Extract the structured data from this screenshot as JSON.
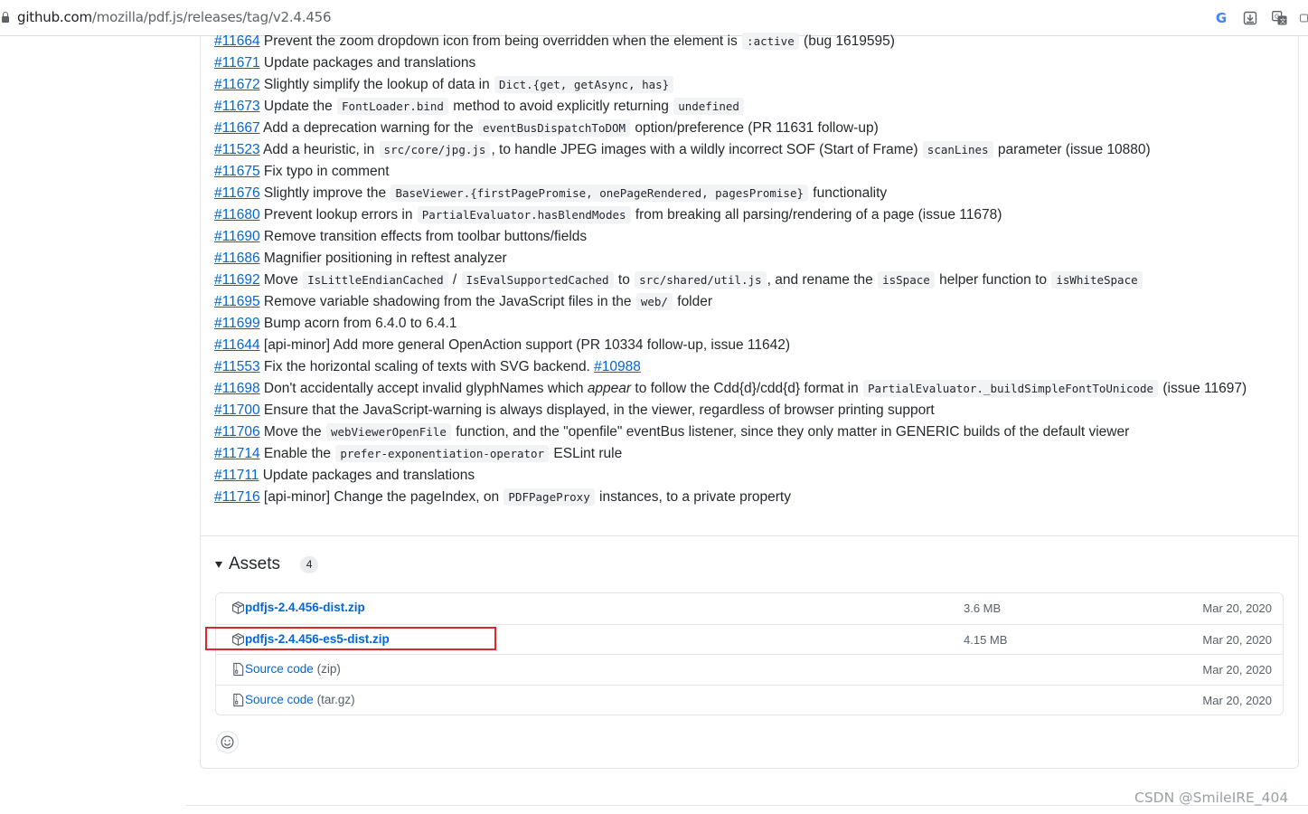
{
  "browser": {
    "url_host": "github.com",
    "url_path": "/mozilla/pdf.js/releases/tag/v2.4.456",
    "icons": [
      "lock-icon",
      "google-icon",
      "download-icon",
      "translate-icon"
    ]
  },
  "notes": [
    {
      "id": "#11664",
      "parts": [
        {
          "t": " Prevent the zoom dropdown icon from being overridden when the element is "
        },
        {
          "c": ":active"
        },
        {
          "t": " (bug 1619595)"
        }
      ]
    },
    {
      "id": "#11671",
      "parts": [
        {
          "t": " Update packages and translations"
        }
      ]
    },
    {
      "id": "#11672",
      "parts": [
        {
          "t": " Slightly simplify the lookup of data in "
        },
        {
          "c": "Dict.{get, getAsync, has}"
        }
      ]
    },
    {
      "id": "#11673",
      "parts": [
        {
          "t": " Update the "
        },
        {
          "c": "FontLoader.bind"
        },
        {
          "t": " method to avoid explicitly returning "
        },
        {
          "c": "undefined"
        }
      ]
    },
    {
      "id": "#11667",
      "parts": [
        {
          "t": " Add a deprecation warning for the "
        },
        {
          "c": "eventBusDispatchToDOM"
        },
        {
          "t": " option/preference (PR 11631 follow-up)"
        }
      ]
    },
    {
      "id": "#11523",
      "parts": [
        {
          "t": " Add a heuristic, in "
        },
        {
          "c": "src/core/jpg.js"
        },
        {
          "t": ", to handle JPEG images with a wildly incorrect SOF (Start of Frame) "
        },
        {
          "c": "scanLines"
        },
        {
          "t": " parameter (issue 10880)"
        }
      ]
    },
    {
      "id": "#11675",
      "parts": [
        {
          "t": " Fix typo in comment"
        }
      ]
    },
    {
      "id": "#11676",
      "parts": [
        {
          "t": " Slightly improve the "
        },
        {
          "c": "BaseViewer.{firstPagePromise, onePageRendered, pagesPromise}"
        },
        {
          "t": " functionality"
        }
      ]
    },
    {
      "id": "#11680",
      "parts": [
        {
          "t": " Prevent lookup errors in "
        },
        {
          "c": "PartialEvaluator.hasBlendModes"
        },
        {
          "t": " from breaking all parsing/rendering of a page (issue 11678)"
        }
      ]
    },
    {
      "id": "#11690",
      "parts": [
        {
          "t": " Remove transition effects from toolbar buttons/fields"
        }
      ]
    },
    {
      "id": "#11686",
      "parts": [
        {
          "t": " Magnifier positioning in reftest analyzer"
        }
      ]
    },
    {
      "id": "#11692",
      "parts": [
        {
          "t": " Move "
        },
        {
          "c": "IsLittleEndianCached"
        },
        {
          "t": " / "
        },
        {
          "c": "IsEvalSupportedCached"
        },
        {
          "t": " to "
        },
        {
          "c": "src/shared/util.js"
        },
        {
          "t": ", and rename the "
        },
        {
          "c": "isSpace"
        },
        {
          "t": " helper function to "
        },
        {
          "c": "isWhiteSpace"
        }
      ]
    },
    {
      "id": "#11695",
      "parts": [
        {
          "t": " Remove variable shadowing from the JavaScript files in the "
        },
        {
          "c": "web/"
        },
        {
          "t": " folder"
        }
      ]
    },
    {
      "id": "#11699",
      "parts": [
        {
          "t": " Bump acorn from 6.4.0 to 6.4.1"
        }
      ]
    },
    {
      "id": "#11644",
      "parts": [
        {
          "t": " [api-minor] Add more general OpenAction support (PR 10334 follow-up, issue 11642)"
        }
      ]
    },
    {
      "id": "#11553",
      "parts": [
        {
          "t": " Fix the horizontal scaling of texts with SVG backend. "
        },
        {
          "a": "#10988"
        }
      ]
    },
    {
      "id": "#11698",
      "parts": [
        {
          "t": " Don't accidentally accept invalid glyphNames which "
        },
        {
          "i": "appear"
        },
        {
          "t": " to follow the Cdd{d}/cdd{d} format in "
        },
        {
          "c": "PartialEvaluator._buildSimpleFontToUnicode"
        },
        {
          "t": " (issue 11697)"
        }
      ]
    },
    {
      "id": "#11700",
      "parts": [
        {
          "t": " Ensure that the JavaScript-warning is always displayed, in the viewer, regardless of browser printing support"
        }
      ]
    },
    {
      "id": "#11706",
      "parts": [
        {
          "t": " Move the "
        },
        {
          "c": "webViewerOpenFile"
        },
        {
          "t": " function, and the \"openfile\" eventBus listener, since they only matter in GENERIC builds of the default viewer"
        }
      ]
    },
    {
      "id": "#11714",
      "parts": [
        {
          "t": " Enable the "
        },
        {
          "c": "prefer-exponentiation-operator"
        },
        {
          "t": " ESLint rule"
        }
      ]
    },
    {
      "id": "#11711",
      "parts": [
        {
          "t": " Update packages and translations"
        }
      ]
    },
    {
      "id": "#11716",
      "parts": [
        {
          "t": " [api-minor] Change the pageIndex, on "
        },
        {
          "c": "PDFPageProxy"
        },
        {
          "t": " instances, to a private property"
        }
      ]
    }
  ],
  "assets": {
    "title": "Assets",
    "count": "4",
    "items": [
      {
        "name": "pdfjs-2.4.456-dist.zip",
        "ext": "",
        "size": "3.6 MB",
        "date": "Mar 20, 2020",
        "kind": "package-icon"
      },
      {
        "name": "pdfjs-2.4.456-es5-dist.zip",
        "ext": "",
        "size": "4.15 MB",
        "date": "Mar 20, 2020",
        "kind": "package-icon"
      },
      {
        "name": "Source code",
        "ext": "(zip)",
        "size": "",
        "date": "Mar 20, 2020",
        "kind": "file-zip-icon"
      },
      {
        "name": "Source code",
        "ext": "(tar.gz)",
        "size": "",
        "date": "Mar 20, 2020",
        "kind": "file-zip-icon"
      }
    ]
  },
  "colors": {
    "link": "#0366d6",
    "highlight": "#e0262a",
    "text": "#24292e",
    "muted": "#586069"
  },
  "watermark": "CSDN @SmileIRE_404"
}
